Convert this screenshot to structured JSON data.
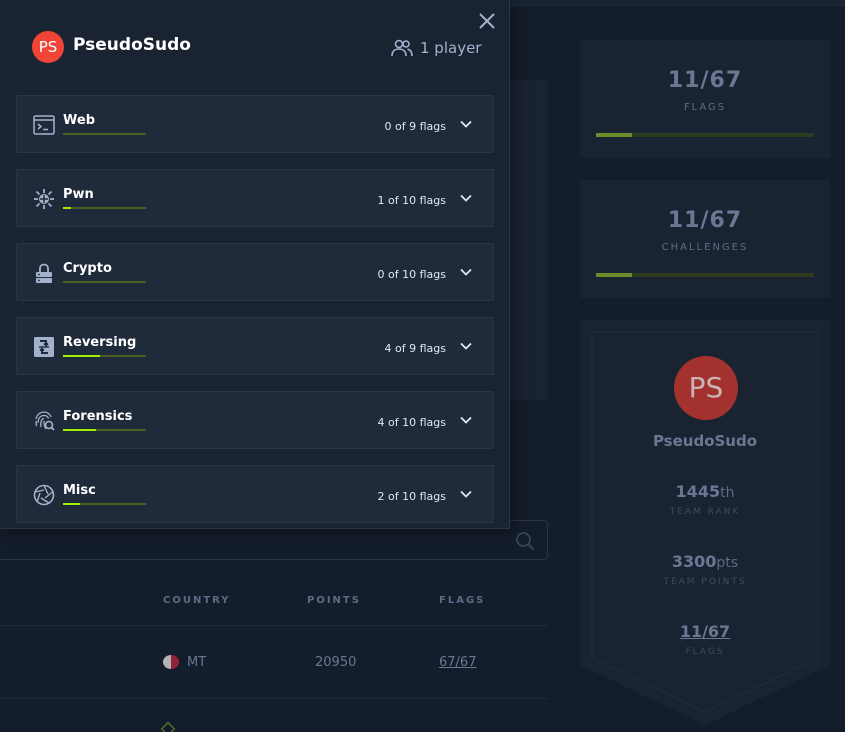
{
  "modal": {
    "avatar_initials": "PS",
    "team_name": "PseudoSudo",
    "players": "1 player",
    "categories": [
      {
        "name": "Web",
        "flags": "0 of 9 flags",
        "progress": 0,
        "icon": "terminal-window-icon"
      },
      {
        "name": "Pwn",
        "flags": "1 of 10 flags",
        "progress": 0.1,
        "icon": "bug-icon"
      },
      {
        "name": "Crypto",
        "flags": "0 of 10 flags",
        "progress": 0,
        "icon": "lock-icon"
      },
      {
        "name": "Reversing",
        "flags": "4 of 9 flags",
        "progress": 0.444,
        "icon": "reverse-arrows-icon"
      },
      {
        "name": "Forensics",
        "flags": "4 of 10 flags",
        "progress": 0.4,
        "icon": "fingerprint-icon"
      },
      {
        "name": "Misc",
        "flags": "2 of 10 flags",
        "progress": 0.2,
        "icon": "aperture-icon"
      }
    ]
  },
  "table": {
    "headers": {
      "country": "COUNTRY",
      "points": "POINTS",
      "flags": "FLAGS"
    },
    "rows": [
      {
        "country": "MT",
        "points": "20950",
        "flags": "67/67"
      }
    ]
  },
  "stats": {
    "flags": {
      "value": "11/67",
      "label": "FLAGS",
      "progress": 0.164
    },
    "challenges": {
      "value": "11/67",
      "label": "CHALLENGES",
      "progress": 0.164
    }
  },
  "profile": {
    "initials": "PS",
    "name": "PseudoSudo",
    "rank_value": "1445",
    "rank_unit": "th",
    "rank_label": "TEAM RANK",
    "points_value": "3300",
    "points_unit": "pts",
    "points_label": "TEAM POINTS",
    "flags_value": "11/67",
    "flags_label": "FLAGS"
  },
  "colors": {
    "accent": "#9fef00",
    "avatar": "#f04438",
    "background": "#141d2b",
    "card": "#1a2332"
  }
}
